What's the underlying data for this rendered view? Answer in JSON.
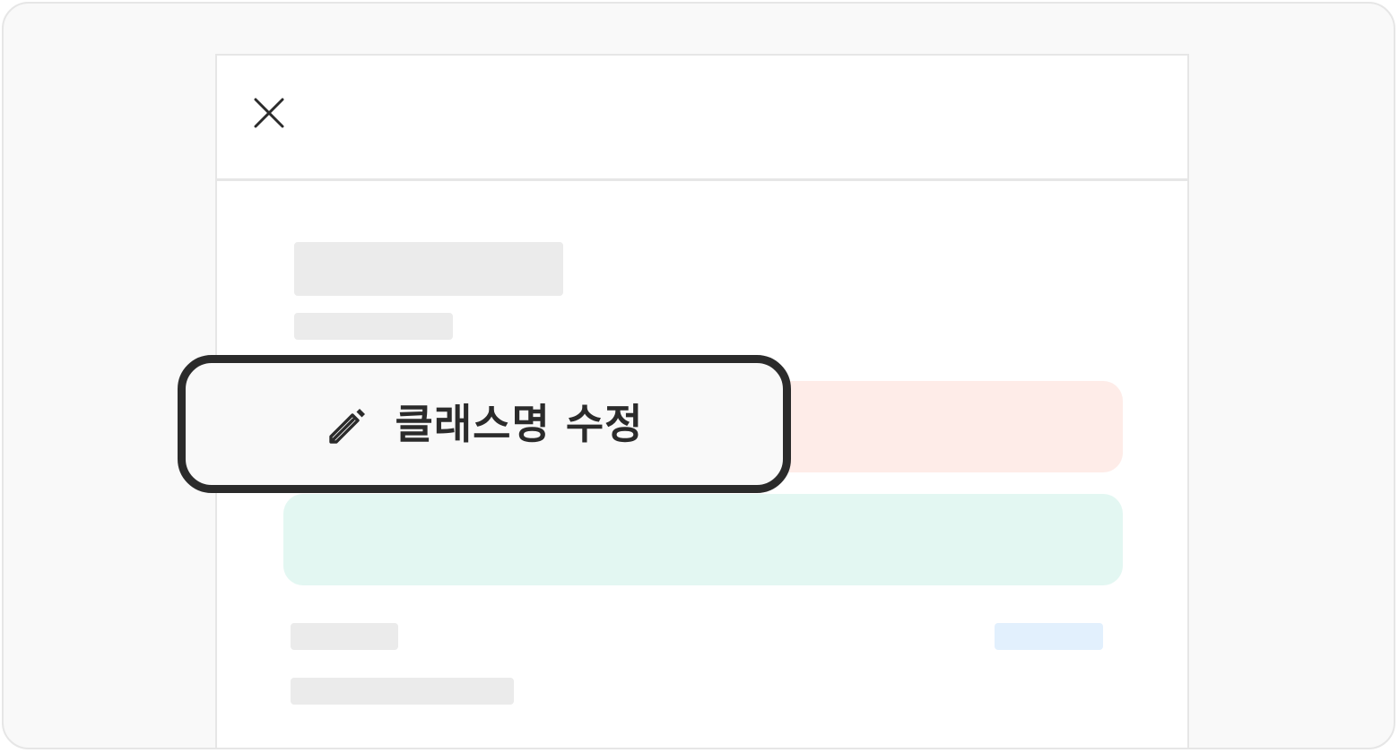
{
  "dialog": {
    "close_icon": "close-icon"
  },
  "action": {
    "label": "클래스명 수정",
    "icon": "pencil-icon"
  },
  "colors": {
    "frame_bg": "#f9f9f9",
    "panel_bg": "#ffffff",
    "placeholder_gray": "#ebebeb",
    "placeholder_red": "#feece8",
    "placeholder_green": "#e3f7f2",
    "placeholder_blue": "#e2f0fd",
    "pill_border": "#2b2b2b"
  }
}
